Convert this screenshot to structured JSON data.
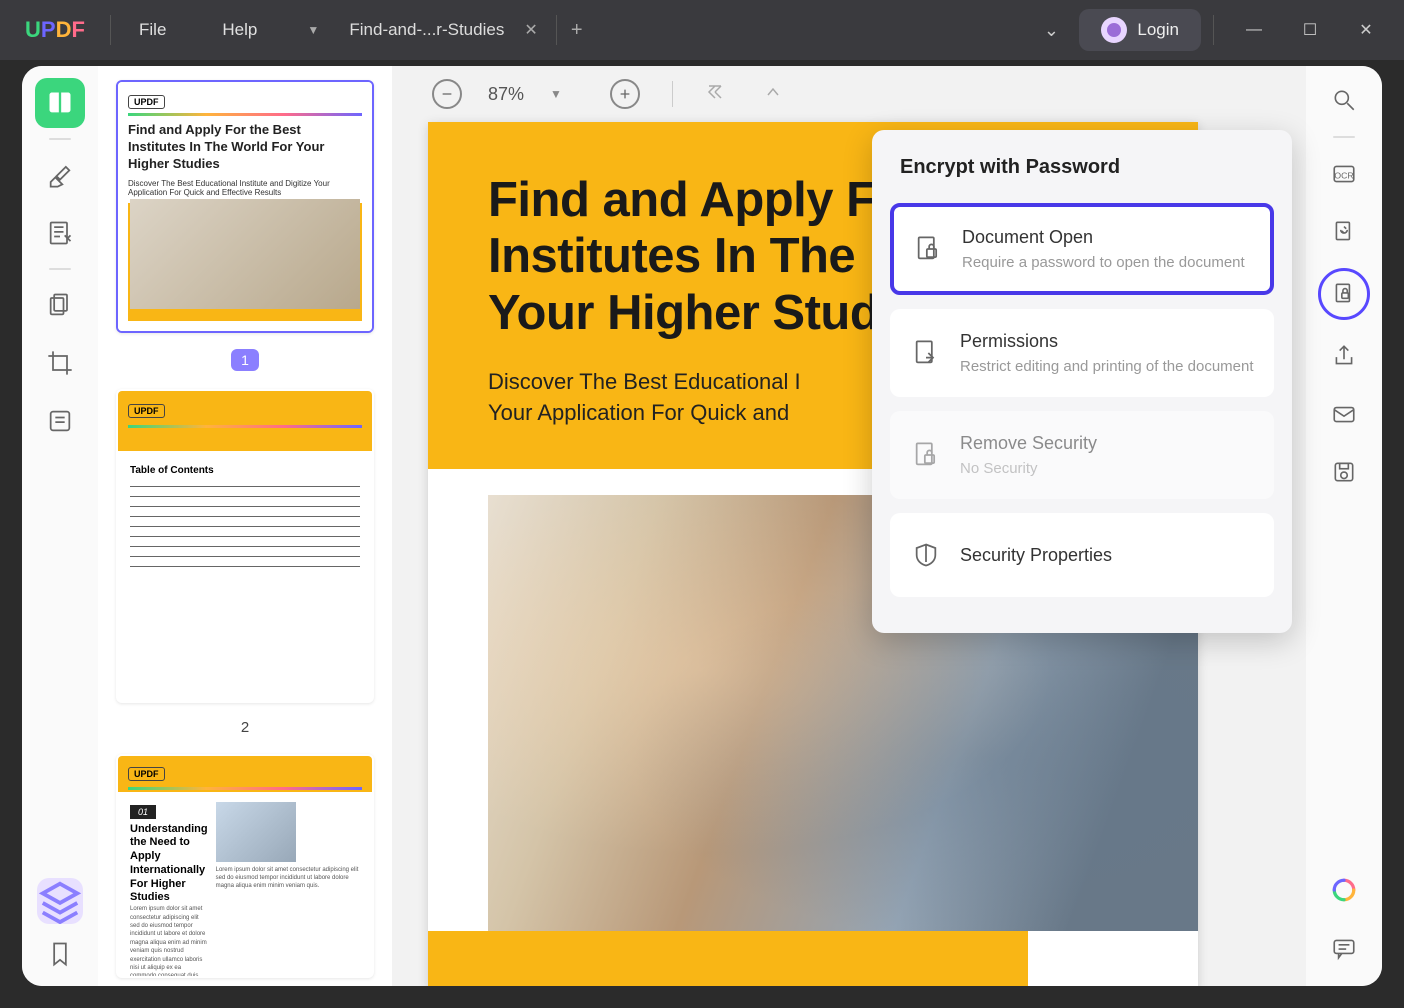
{
  "titlebar": {
    "logo": "UPDF",
    "menu": {
      "file": "File",
      "help": "Help"
    },
    "tab": {
      "title": "Find-and-...r-Studies"
    },
    "login": "Login"
  },
  "left_tools": {
    "names": [
      "reader-mode",
      "highlighter-tool",
      "edit-text-tool",
      "organize-pages-tool",
      "crop-tool",
      "redact-tool"
    ]
  },
  "zoom": {
    "value": "87%"
  },
  "page": {
    "heading_line1": "Find and Apply F",
    "heading_line2": "Institutes In The",
    "heading_line3": "Your Higher Stud",
    "subtitle_line1": "Discover The Best Educational I",
    "subtitle_line2": "Your Application For Quick and"
  },
  "thumbs": {
    "t1": {
      "title": "Find and Apply For the Best Institutes In The World For Your Higher Studies",
      "subtitle": "Discover The Best Educational Institute and Digitize Your Application For Quick and Effective Results",
      "label": "1"
    },
    "t2": {
      "toc": "Table of Contents",
      "label": "2"
    },
    "t3": {
      "badge": "01",
      "title": "Understanding the Need to Apply Internationally For Higher Studies"
    }
  },
  "popup": {
    "title": "Encrypt with Password",
    "items": [
      {
        "title": "Document Open",
        "subtitle": "Require a password to open the document",
        "icon": "lock-doc"
      },
      {
        "title": "Permissions",
        "subtitle": "Restrict editing and printing of the document",
        "icon": "permissions"
      },
      {
        "title": "Remove Security",
        "subtitle": "No Security",
        "icon": "unlock-doc"
      },
      {
        "title": "Security Properties",
        "subtitle": "",
        "icon": "shield"
      }
    ]
  },
  "right_tools": {
    "names": [
      "search-icon",
      "ocr-icon",
      "convert-icon",
      "protect-icon",
      "share-icon",
      "email-icon",
      "save-icon"
    ]
  }
}
